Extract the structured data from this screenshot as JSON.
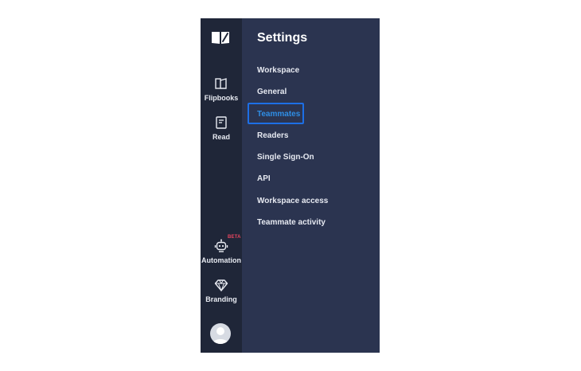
{
  "rail": {
    "logo_icon": "open-book-icon",
    "items": [
      {
        "label": "Flipbooks",
        "icon": "flipbook-icon"
      },
      {
        "label": "Read",
        "icon": "read-icon"
      },
      {
        "label": "Automation",
        "icon": "robot-icon",
        "badge": "BETA"
      },
      {
        "label": "Branding",
        "icon": "diamond-icon"
      }
    ],
    "avatar_icon": "user-avatar-icon"
  },
  "settings": {
    "title": "Settings",
    "menu": [
      {
        "label": "Workspace"
      },
      {
        "label": "General"
      },
      {
        "label": "Teammates",
        "active": true
      },
      {
        "label": "Readers"
      },
      {
        "label": "Single Sign-On"
      },
      {
        "label": "API"
      },
      {
        "label": "Workspace access"
      },
      {
        "label": "Teammate activity"
      }
    ]
  },
  "colors": {
    "rail_bg": "#1f2638",
    "panel_bg": "#2b3450",
    "active_text": "#2f8ee6",
    "highlight_border": "#1d6fe6",
    "beta_badge": "#e8465f"
  }
}
